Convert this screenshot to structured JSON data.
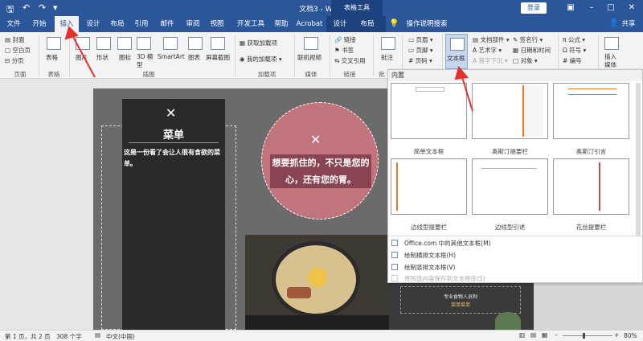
{
  "title_bar": {
    "title": "文档3  -  Word",
    "context_tab_group": "表格工具",
    "login_label": "登录",
    "window_controls": [
      "restore-icon",
      "minimize-icon",
      "maximize-icon",
      "close-icon"
    ]
  },
  "tabs": [
    "文件",
    "开始",
    "插入",
    "设计",
    "布局",
    "引用",
    "邮件",
    "审阅",
    "视图",
    "开发工具",
    "帮助",
    "Acrobat",
    "设计",
    "布局"
  ],
  "active_tab": "插入",
  "tell_me": "操作说明搜索",
  "share": "共享",
  "ribbon": {
    "pages": {
      "items": [
        "封面",
        "空白页",
        "分页"
      ],
      "group": "页面"
    },
    "table": {
      "label": "表格",
      "group": "表格"
    },
    "illustrations": {
      "items": [
        "图片",
        "形状",
        "图标",
        "3D 模型",
        "SmartArt",
        "图表",
        "屏幕截图"
      ],
      "group": "插图"
    },
    "addins": {
      "items": [
        "获取加载项",
        "我的加载项"
      ],
      "group": "加载项"
    },
    "media": {
      "label": "联机视频",
      "group": "媒体"
    },
    "links": {
      "items": [
        "链接",
        "书签",
        "交叉引用"
      ],
      "group": "链接"
    },
    "comments": {
      "label": "批注",
      "group": "批"
    },
    "headerfooter": {
      "items": [
        "页眉",
        "页脚",
        "页码"
      ]
    },
    "text": {
      "textbox": "文本框",
      "items": [
        "文档部件",
        "艺术字",
        "首字下沉",
        "签名行",
        "日期和时间",
        "对象"
      ]
    },
    "symbols": {
      "items": [
        "公式",
        "符号",
        "编号"
      ]
    },
    "media2": {
      "label": "插入媒体"
    }
  },
  "document": {
    "menu_title": "菜单",
    "menu_desc": "这是一份看了会让人很有食欲的菜单。",
    "quote": "想要抓住的，不只是您的心，还有您的胃。",
    "bottom_heading": "专业食物人员制",
    "bottom_sub": "菜单菜单"
  },
  "gallery": {
    "header": "内置",
    "thumbs": [
      "简单文本框",
      "奥斯汀提要栏",
      "奥斯汀引言",
      "边线型提要栏",
      "边线型引述",
      "花丝提要栏"
    ],
    "items": [
      {
        "label": "Office.com 中的其他文本框(M)",
        "enabled": true
      },
      {
        "label": "绘制横排文本框(H)",
        "enabled": true
      },
      {
        "label": "绘制竖排文本框(V)",
        "enabled": true
      },
      {
        "label": "将所选内容保存到文本框库(S)",
        "enabled": false
      }
    ]
  },
  "status_bar": {
    "page": "第 1 页，共 2 页",
    "words": "308 个字",
    "language": "中文(中国)",
    "zoom": "80%"
  },
  "colors": {
    "brand": "#2b579a",
    "arrow": "#e5312d",
    "circle": "#c2747d"
  }
}
